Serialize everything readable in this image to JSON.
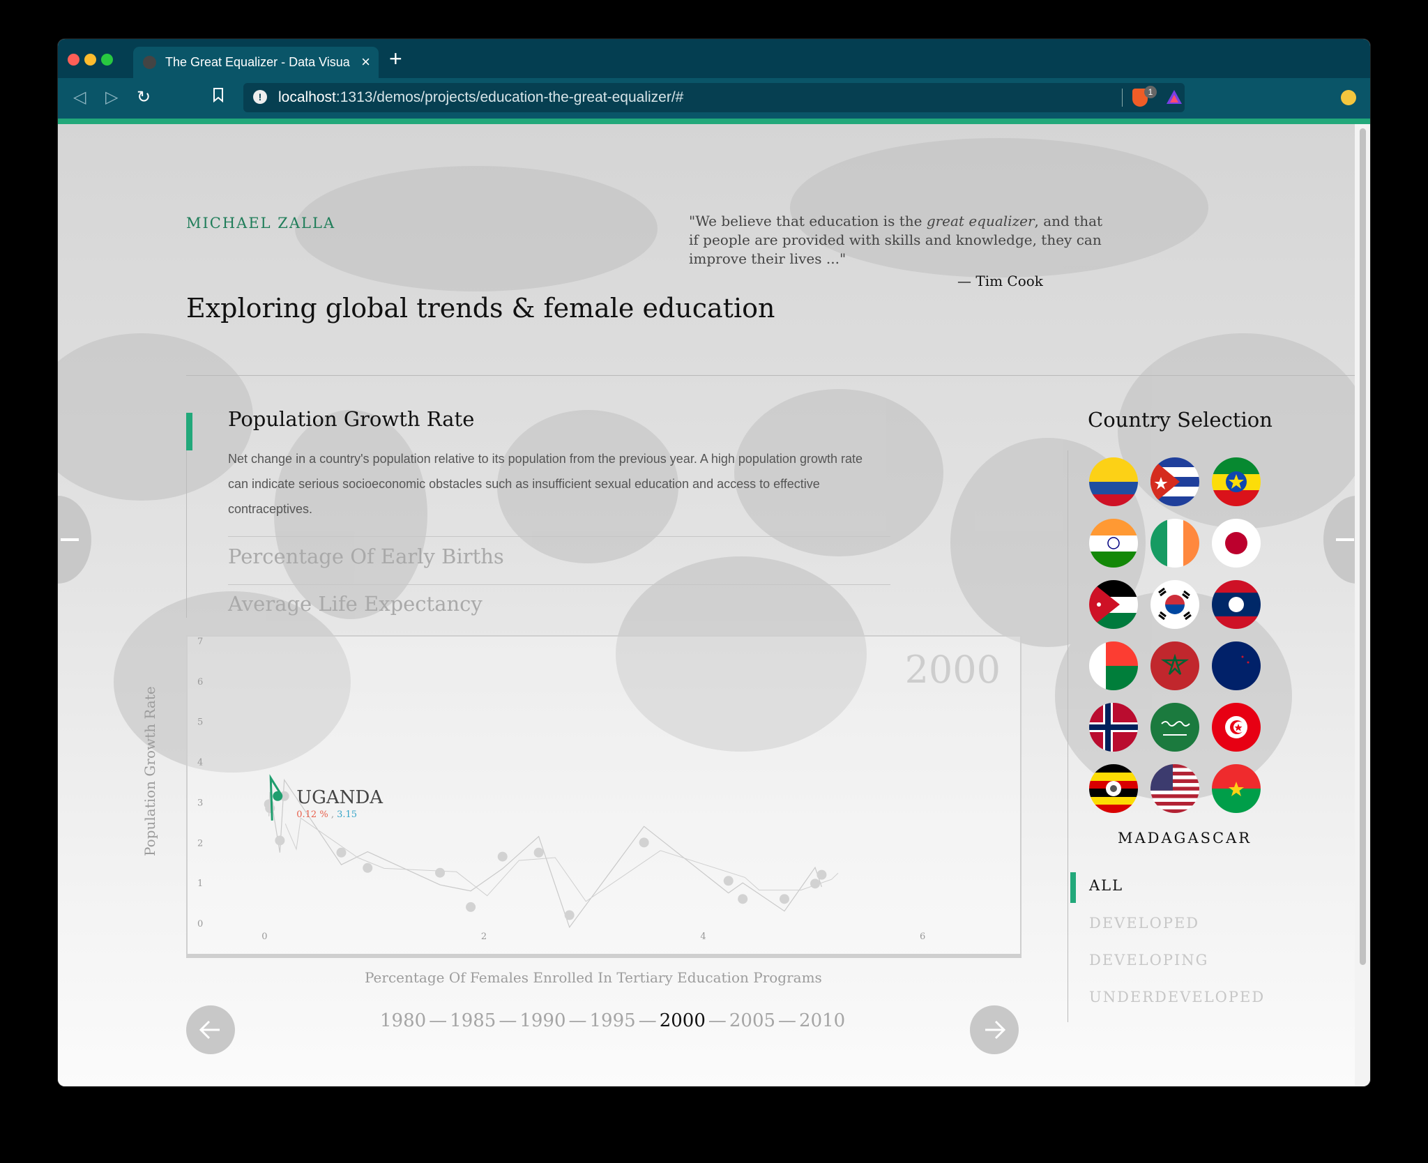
{
  "browser": {
    "tab_title": "The Great Equalizer - Data Visua",
    "url_host": "localhost",
    "url_rest": ":1313/demos/projects/education-the-great-equalizer/#",
    "shield_badge": "1",
    "colors": {
      "tabbar": "#043e51",
      "toolbar": "#0a5568",
      "accent": "#22a87a"
    }
  },
  "page": {
    "author": "MICHAEL ZALLA",
    "quote": {
      "text_before": "\"We believe that education is the ",
      "emphasis": "great equalizer",
      "text_after": ", and that if people are provided with skills and knowledge, they can improve their lives ...\"",
      "attribution": "— Tim Cook"
    },
    "headline": "Exploring global trends & female education"
  },
  "metrics": {
    "active": {
      "title": "Population Growth Rate",
      "description": "Net change in a country's population relative to its population from the previous year. A high population growth rate can indicate serious socioeconomic obstacles such as insufficient sexual education and access to effective contraceptives."
    },
    "others": [
      "Percentage Of Early Births",
      "Average Life Expectancy"
    ]
  },
  "chart_data": {
    "type": "scatter",
    "xlabel": "Percentage Of Females Enrolled In Tertiary Education Programs",
    "ylabel": "Population Growth Rate",
    "x_ticks": [
      "0",
      "2",
      "4",
      "6"
    ],
    "y_ticks": [
      "0",
      "1",
      "2",
      "3",
      "4",
      "5",
      "6",
      "7"
    ],
    "xlim": [
      -0.6,
      6.8
    ],
    "ylim": [
      -0.5,
      7
    ],
    "year": "2000",
    "highlight": {
      "name": "UGANDA",
      "x": 0.12,
      "y": 3.15,
      "x_label": "0.12 %",
      "separator": " , ",
      "y_label": "3.15"
    },
    "points": [
      {
        "x": 0.04,
        "y": 2.95
      },
      {
        "x": 0.18,
        "y": 3.15
      },
      {
        "x": 0.05,
        "y": 2.85
      },
      {
        "x": 0.14,
        "y": 2.05
      },
      {
        "x": 0.7,
        "y": 1.75
      },
      {
        "x": 0.94,
        "y": 1.37
      },
      {
        "x": 1.6,
        "y": 1.25
      },
      {
        "x": 1.88,
        "y": 0.4
      },
      {
        "x": 2.17,
        "y": 1.65
      },
      {
        "x": 2.5,
        "y": 1.75
      },
      {
        "x": 2.78,
        "y": 0.2
      },
      {
        "x": 3.46,
        "y": 2.0
      },
      {
        "x": 4.23,
        "y": 1.05
      },
      {
        "x": 4.36,
        "y": 0.6
      },
      {
        "x": 4.74,
        "y": 0.6
      },
      {
        "x": 5.02,
        "y": 0.98
      },
      {
        "x": 5.08,
        "y": 1.2
      }
    ],
    "trail_color": "#1f9e6e",
    "x_value_color": "#e8604c",
    "y_value_color": "#36a5c8"
  },
  "timeline": {
    "years": [
      "1980",
      "1985",
      "1990",
      "1995",
      "2000",
      "2005",
      "2010"
    ],
    "selected": "2000",
    "separator": "—"
  },
  "country_selection": {
    "title": "Country Selection",
    "flags": [
      "colombia",
      "cuba",
      "ethiopia",
      "india",
      "ireland",
      "japan",
      "jordan",
      "south-korea",
      "laos",
      "madagascar",
      "morocco",
      "new-zealand",
      "norway",
      "saudi-arabia",
      "tunisia",
      "uganda",
      "united-states",
      "burkina-faso"
    ],
    "hovered": "MADAGASCAR",
    "filters": [
      "ALL",
      "DEVELOPED",
      "DEVELOPING",
      "UNDERDEVELOPED"
    ],
    "active_filter": "ALL"
  }
}
